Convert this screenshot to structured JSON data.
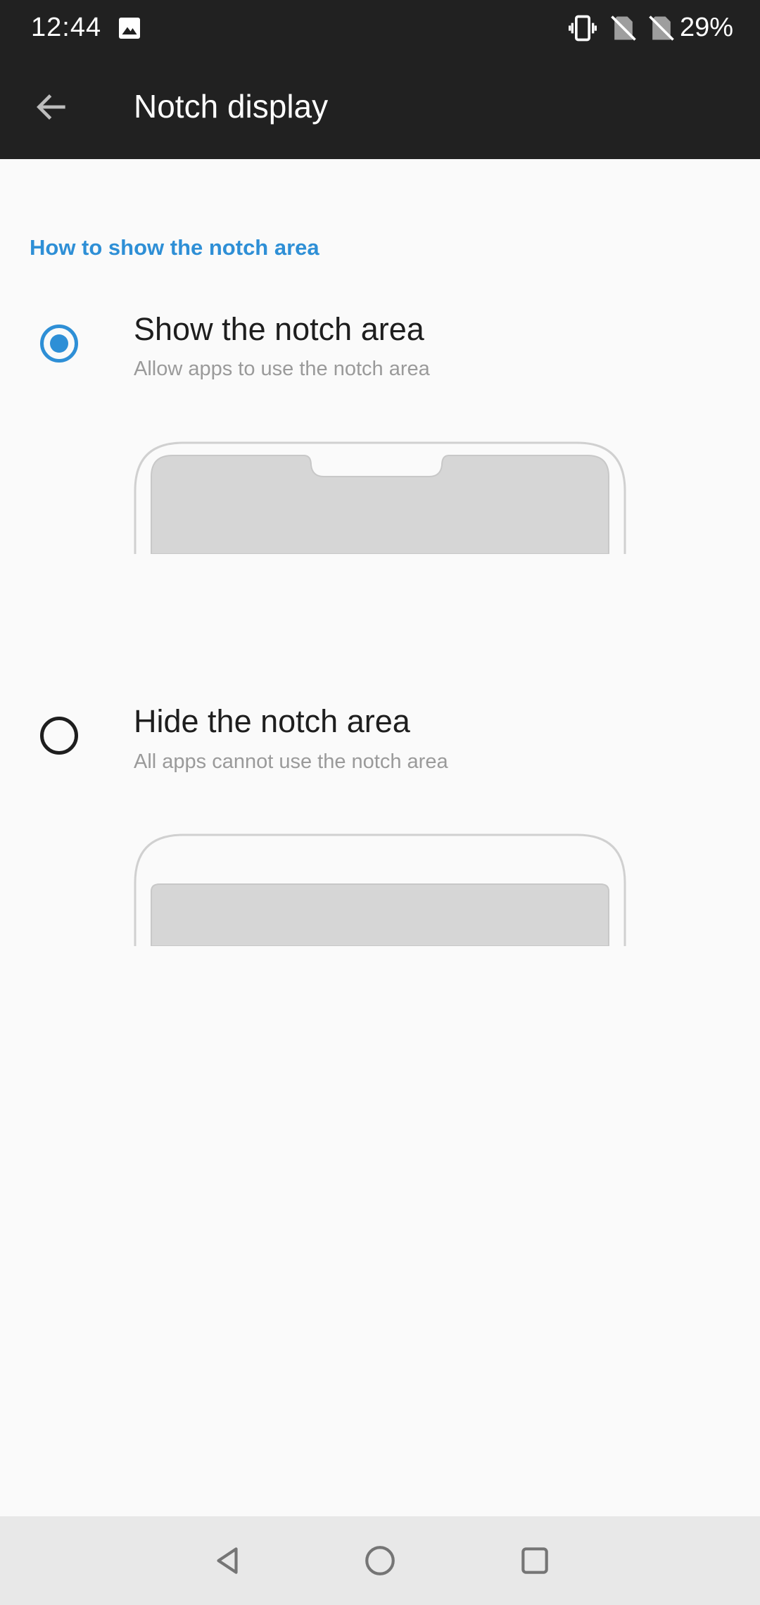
{
  "status_bar": {
    "time": "12:44",
    "battery_percent": "29%",
    "icons": [
      "gallery-icon",
      "vibrate-icon",
      "no-sim-icon",
      "no-sim-icon"
    ]
  },
  "app_bar": {
    "title": "Notch display",
    "back_icon": "arrow-back-icon"
  },
  "section": {
    "header": "How to show the notch area"
  },
  "options": [
    {
      "title": "Show the notch area",
      "subtitle": "Allow apps to use the notch area",
      "selected": true
    },
    {
      "title": "Hide the notch area",
      "subtitle": "All apps cannot use the notch area",
      "selected": false
    }
  ],
  "nav_bar": {
    "buttons": [
      "back-icon",
      "home-icon",
      "recents-icon"
    ]
  },
  "colors": {
    "accent": "#2e8fd6",
    "bar_background": "#212121",
    "page_background": "#fafafa"
  }
}
